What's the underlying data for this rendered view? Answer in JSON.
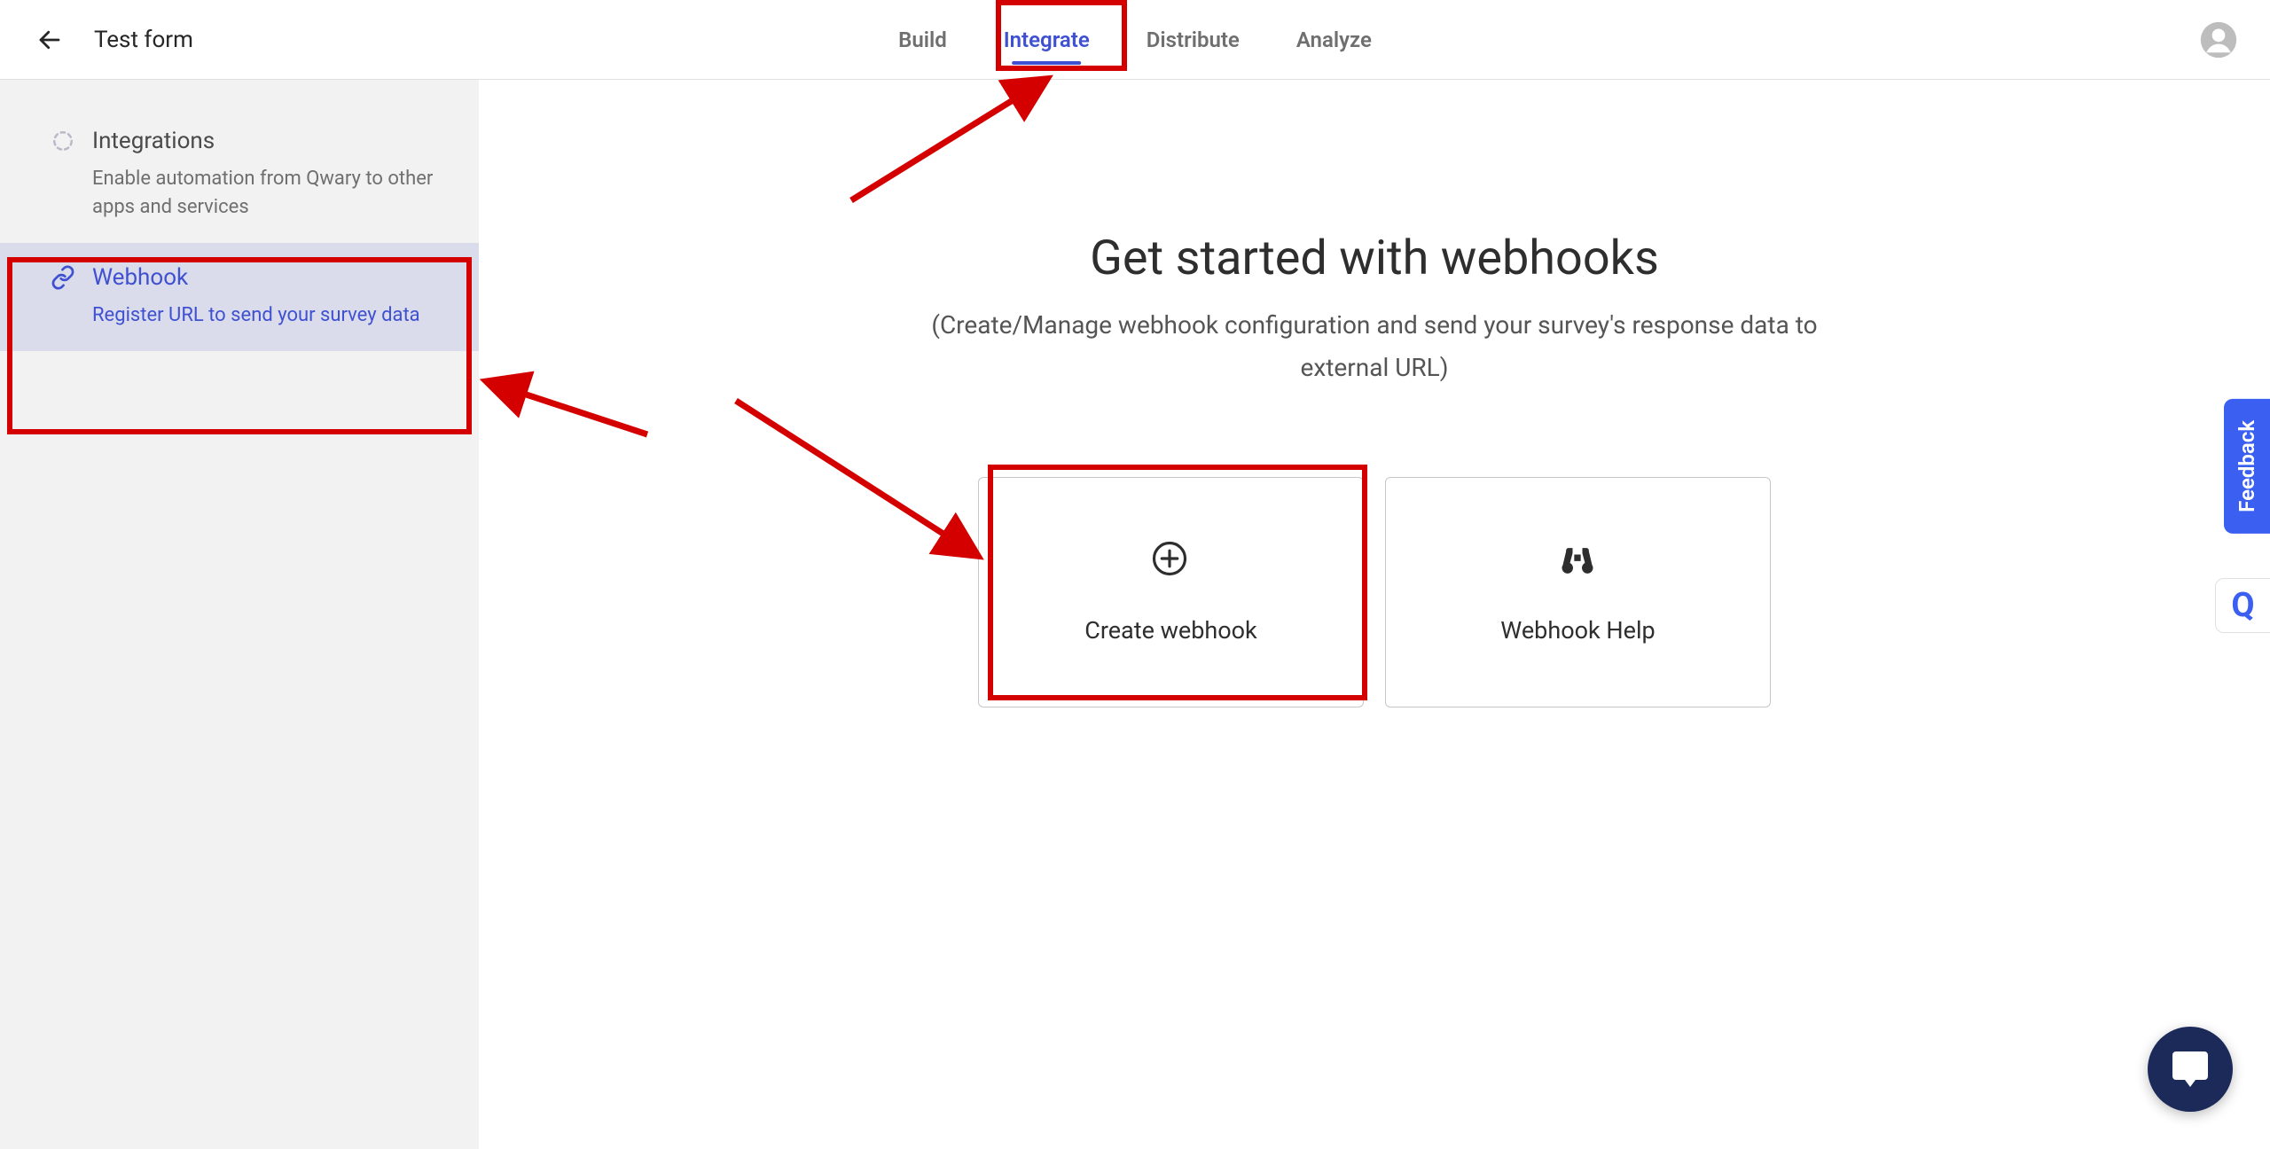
{
  "header": {
    "form_title": "Test form",
    "tabs": [
      {
        "label": "Build",
        "active": false
      },
      {
        "label": "Integrate",
        "active": true
      },
      {
        "label": "Distribute",
        "active": false
      },
      {
        "label": "Analyze",
        "active": false
      }
    ]
  },
  "sidebar": {
    "items": [
      {
        "icon": "spinner-icon",
        "title": "Integrations",
        "desc": "Enable automation from Qwary to other apps and services",
        "selected": false
      },
      {
        "icon": "link-icon",
        "title": "Webhook",
        "desc": "Register URL to send your survey data",
        "selected": true
      }
    ]
  },
  "main": {
    "heading": "Get started with webhooks",
    "subtitle": "(Create/Manage webhook configuration and send your survey's response data to external URL)",
    "cards": [
      {
        "icon": "plus-circle-icon",
        "label": "Create webhook"
      },
      {
        "icon": "binoculars-icon",
        "label": "Webhook Help"
      }
    ]
  },
  "widgets": {
    "feedback_label": "Feedback",
    "q_label": "Q"
  }
}
